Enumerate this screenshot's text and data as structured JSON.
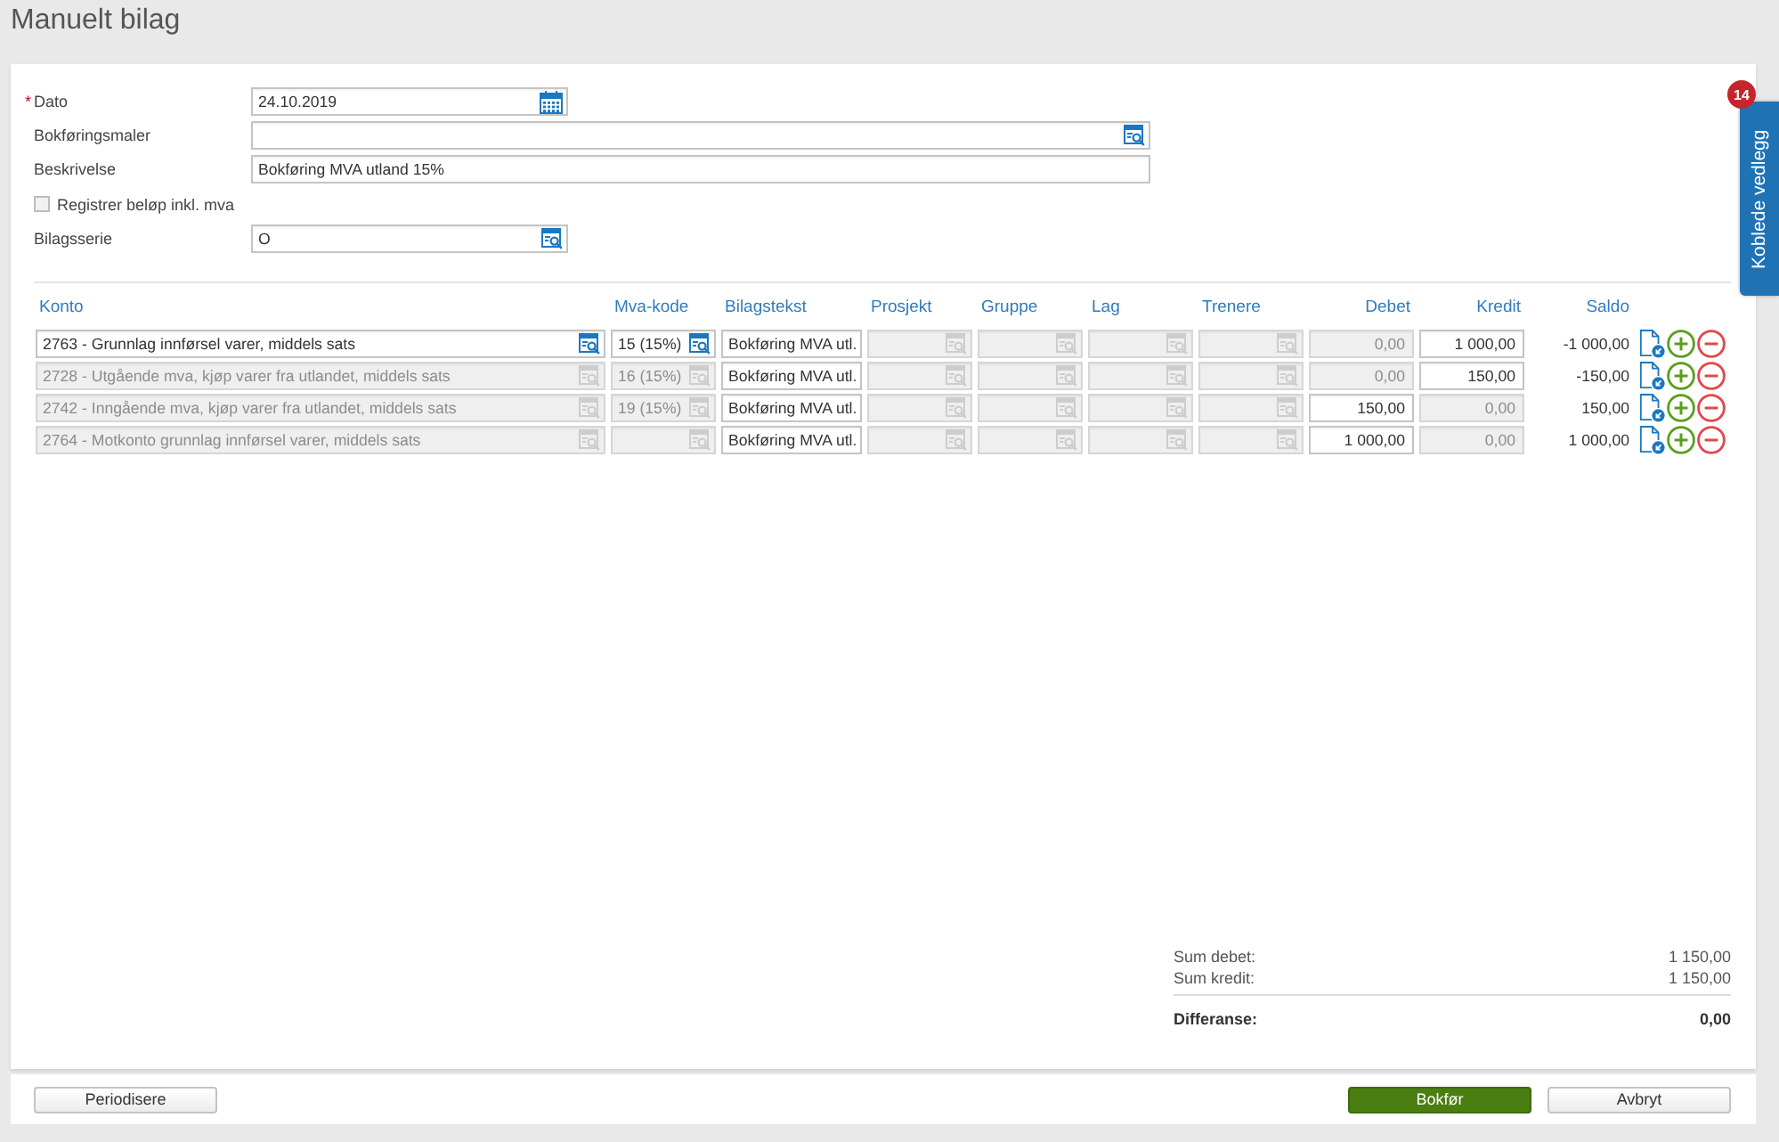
{
  "page": {
    "title": "Manuelt bilag"
  },
  "side_tab": {
    "label": "Koblede vedlegg",
    "badge": "14"
  },
  "form": {
    "fields": [
      {
        "kind": "date",
        "label": "Dato",
        "required_mark": "*",
        "value": "24.10.2019"
      },
      {
        "kind": "lookup",
        "label": "Bokføringsmaler"
      },
      {
        "kind": "text",
        "label": "Beskrivelse",
        "value": "Bokføring MVA utland 15%"
      },
      {
        "kind": "checkbox",
        "label": "Registrer beløp inkl. mva",
        "checked": false
      },
      {
        "kind": "series",
        "label": "Bilagsserie",
        "value": "O"
      }
    ]
  },
  "table": {
    "columns": [
      {
        "label": "Konto",
        "kind": "lookup"
      },
      {
        "label": "Mva-kode",
        "kind": "lookup"
      },
      {
        "label": "Bilagstekst",
        "kind": "text"
      },
      {
        "label": "Prosjekt",
        "kind": "lookup"
      },
      {
        "label": "Gruppe",
        "kind": "lookup"
      },
      {
        "label": "Lag",
        "kind": "lookup"
      },
      {
        "label": "Trenere",
        "kind": "lookup"
      },
      {
        "label": "Debet",
        "kind": "amount"
      },
      {
        "label": "Kredit",
        "kind": "amount"
      },
      {
        "label": "Saldo",
        "kind": "total"
      }
    ],
    "rows": [
      {
        "cells": [
          {
            "value": "2763 - Grunnlag innførsel varer, middels sats",
            "disabled": false
          },
          {
            "value": "15 (15%)",
            "disabled": false
          },
          {
            "value": "Bokføring MVA utl.",
            "disabled": false
          },
          {
            "disabled": true
          },
          {
            "disabled": true
          },
          {
            "disabled": true
          },
          {
            "disabled": true
          },
          {
            "value": "0,00",
            "disabled": true
          },
          {
            "value": "1 000,00",
            "disabled": false
          },
          {
            "value": "-1 000,00"
          }
        ]
      },
      {
        "cells": [
          {
            "value": "2728 - Utgående mva, kjøp varer fra utlandet, middels sats",
            "disabled": true
          },
          {
            "value": "16 (15%)",
            "disabled": true
          },
          {
            "value": "Bokføring MVA utl.",
            "disabled": false
          },
          {
            "disabled": true
          },
          {
            "disabled": true
          },
          {
            "disabled": true
          },
          {
            "disabled": true
          },
          {
            "value": "0,00",
            "disabled": true
          },
          {
            "value": "150,00",
            "disabled": false
          },
          {
            "value": "-150,00"
          }
        ]
      },
      {
        "cells": [
          {
            "value": "2742 - Inngående mva, kjøp varer fra utlandet, middels sats",
            "disabled": true
          },
          {
            "value": "19 (15%)",
            "disabled": true
          },
          {
            "value": "Bokføring MVA utl.",
            "disabled": false
          },
          {
            "disabled": true
          },
          {
            "disabled": true
          },
          {
            "disabled": true
          },
          {
            "disabled": true
          },
          {
            "value": "150,00",
            "disabled": false
          },
          {
            "value": "0,00",
            "disabled": true
          },
          {
            "value": "150,00"
          }
        ]
      },
      {
        "cells": [
          {
            "value": "2764 - Motkonto grunnlag innførsel varer, middels sats",
            "disabled": true
          },
          {
            "disabled": true
          },
          {
            "value": "Bokføring MVA utl.",
            "disabled": false
          },
          {
            "disabled": true
          },
          {
            "disabled": true
          },
          {
            "disabled": true
          },
          {
            "disabled": true
          },
          {
            "value": "1 000,00",
            "disabled": false
          },
          {
            "value": "0,00",
            "disabled": true
          },
          {
            "value": "1 000,00"
          }
        ]
      }
    ]
  },
  "totals": [
    {
      "label": "Sum debet:",
      "value": "1 150,00"
    },
    {
      "label": "Sum kredit:",
      "value": "1 150,00"
    }
  ],
  "difference": {
    "label": "Differanse:",
    "value": "0,00"
  },
  "buttons": [
    {
      "label": "Periodisere",
      "kind": "secondary"
    },
    {
      "label": "Bokfør",
      "kind": "primary"
    },
    {
      "label": "Avbryt",
      "kind": "secondary"
    }
  ]
}
